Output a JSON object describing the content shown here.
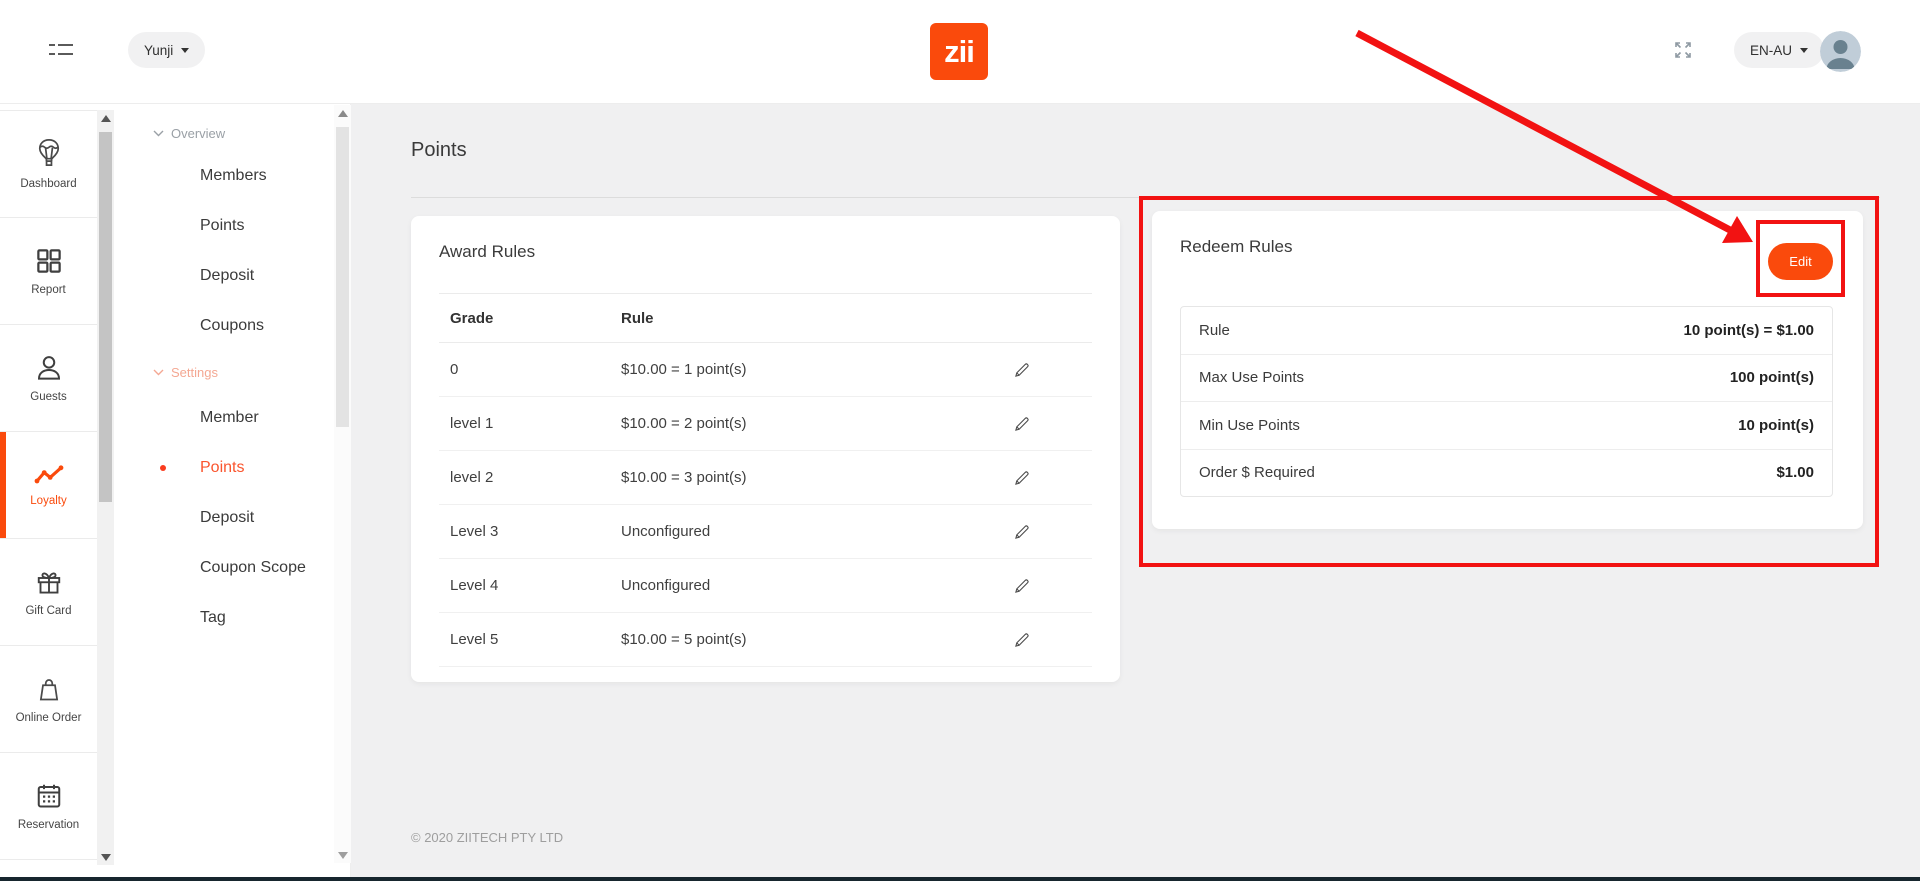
{
  "header": {
    "workspace": "Yunji",
    "logo_text": "zii",
    "language": "EN-AU"
  },
  "sidebar": {
    "items": [
      {
        "label": "Dashboard",
        "icon": "balloon-icon",
        "active": false
      },
      {
        "label": "Report",
        "icon": "grid-icon",
        "active": false
      },
      {
        "label": "Guests",
        "icon": "person-icon",
        "active": false
      },
      {
        "label": "Loyalty",
        "icon": "line-chart-icon",
        "active": true
      },
      {
        "label": "Gift Card",
        "icon": "gift-icon",
        "active": false
      },
      {
        "label": "Online Order",
        "icon": "shopping-bag-icon",
        "active": false
      },
      {
        "label": "Reservation",
        "icon": "calendar-icon",
        "active": false
      }
    ]
  },
  "submenu": {
    "sections": [
      {
        "label": "Overview",
        "items": [
          {
            "label": "Members",
            "active": false
          },
          {
            "label": "Points",
            "active": false
          },
          {
            "label": "Deposit",
            "active": false
          },
          {
            "label": "Coupons",
            "active": false
          }
        ]
      },
      {
        "label": "Settings",
        "items": [
          {
            "label": "Member",
            "active": false
          },
          {
            "label": "Points",
            "active": true
          },
          {
            "label": "Deposit",
            "active": false
          },
          {
            "label": "Coupon Scope",
            "active": false
          },
          {
            "label": "Tag",
            "active": false
          }
        ]
      }
    ]
  },
  "main": {
    "title": "Points",
    "award_card": {
      "title": "Award Rules",
      "columns": [
        "Grade",
        "Rule"
      ],
      "rows": [
        {
          "grade": "0",
          "rule": "$10.00 = 1 point(s)"
        },
        {
          "grade": "level 1",
          "rule": "$10.00 = 2 point(s)"
        },
        {
          "grade": "level 2",
          "rule": "$10.00 = 3 point(s)"
        },
        {
          "grade": "Level 3",
          "rule": "Unconfigured"
        },
        {
          "grade": "Level 4",
          "rule": "Unconfigured"
        },
        {
          "grade": "Level 5",
          "rule": "$10.00 = 5 point(s)"
        }
      ]
    },
    "redeem_card": {
      "title": "Redeem Rules",
      "edit_label": "Edit",
      "rows": [
        {
          "label": "Rule",
          "value": "10 point(s) = $1.00"
        },
        {
          "label": "Max Use Points",
          "value": "100 point(s)"
        },
        {
          "label": "Min Use Points",
          "value": "10 point(s)"
        },
        {
          "label": "Order $ Required",
          "value": "$1.00"
        }
      ]
    },
    "footer": "© 2020 ZIITECH PTY LTD"
  },
  "colors": {
    "accent": "#fa4a0c",
    "annotation_red": "#f21212",
    "settings_muted": "#f4a893"
  }
}
